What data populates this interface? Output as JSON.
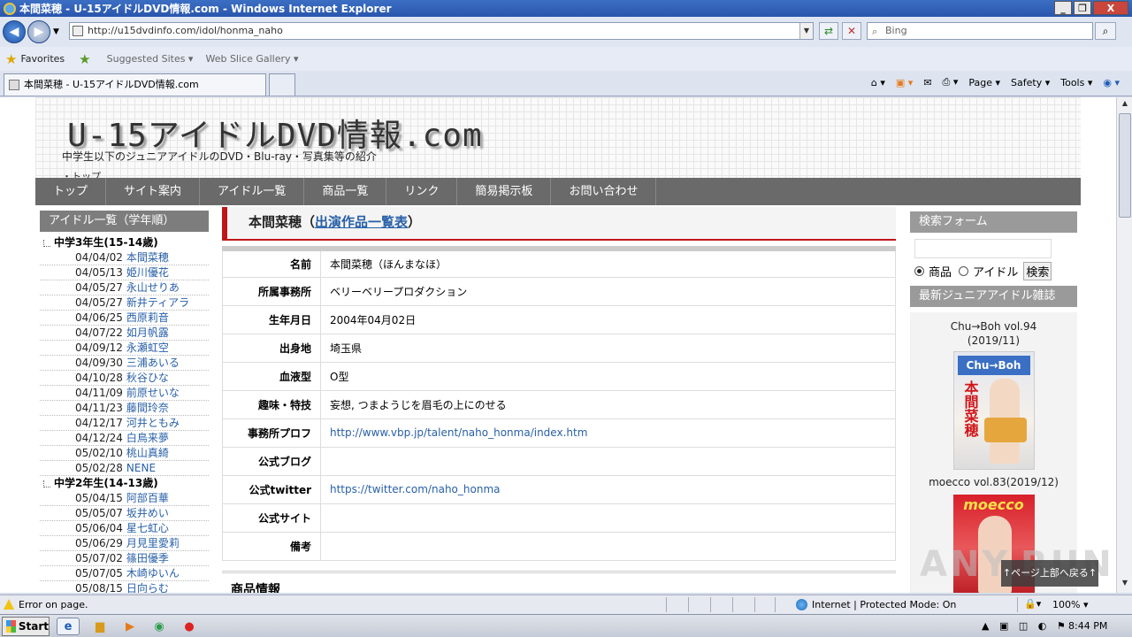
{
  "window": {
    "title": "本間菜穂 - U-15アイドルDVD情報.com - Windows Internet Explorer",
    "controls": [
      "_",
      "❐",
      "X"
    ]
  },
  "browser": {
    "address": "http://u15dvdinfo.com/idol/honma_naho",
    "search_placeholder": "Bing",
    "favorites_label": "Favorites",
    "suggested_sites": "Suggested Sites ▾",
    "web_slice": "Web Slice Gallery ▾",
    "tab_title": "本間菜穂 - U-15アイドルDVD情報.com",
    "commands": [
      "Page ▾",
      "Safety ▾",
      "Tools ▾"
    ]
  },
  "site": {
    "logo": "U-15アイドルDVD情報.com",
    "tagline": "中学生以下のジュニアアイドルのDVD・Blu-ray・写真集等の紹介",
    "crumb": "・トップ",
    "nav": [
      "トップ",
      "サイト案内",
      "アイドル一覧",
      "商品一覧",
      "リンク",
      "簡易掲示板",
      "お問い合わせ"
    ]
  },
  "left_sidebar": {
    "title": "アイドル一覧（学年順）",
    "groups": [
      {
        "grade": "中学3年生(15-14歳)",
        "idols": [
          {
            "date": "04/04/02",
            "name": "本間菜穂"
          },
          {
            "date": "04/05/13",
            "name": "姫川優花"
          },
          {
            "date": "04/05/27",
            "name": "永山せりあ"
          },
          {
            "date": "04/05/27",
            "name": "新井ティアラ"
          },
          {
            "date": "04/06/25",
            "name": "西原莉音"
          },
          {
            "date": "04/07/22",
            "name": "如月帆露"
          },
          {
            "date": "04/09/12",
            "name": "永瀬虹空"
          },
          {
            "date": "04/09/30",
            "name": "三浦あいる"
          },
          {
            "date": "04/10/28",
            "name": "秋谷ひな"
          },
          {
            "date": "04/11/09",
            "name": "前原せいな"
          },
          {
            "date": "04/11/23",
            "name": "藤間玲奈"
          },
          {
            "date": "04/12/17",
            "name": "河井ともみ"
          },
          {
            "date": "04/12/24",
            "name": "白鳥来夢"
          },
          {
            "date": "05/02/10",
            "name": "桃山真綺"
          },
          {
            "date": "05/02/28",
            "name": "NENE"
          }
        ]
      },
      {
        "grade": "中学2年生(14-13歳)",
        "idols": [
          {
            "date": "05/04/15",
            "name": "阿部百華"
          },
          {
            "date": "05/05/07",
            "name": "坂井めい"
          },
          {
            "date": "05/06/04",
            "name": "星七虹心"
          },
          {
            "date": "05/06/29",
            "name": "月見里愛莉"
          },
          {
            "date": "05/07/02",
            "name": "篠田優季"
          },
          {
            "date": "05/07/05",
            "name": "木崎ゆいん"
          },
          {
            "date": "05/08/15",
            "name": "日向らむ"
          }
        ]
      }
    ]
  },
  "main": {
    "title_name": "本間菜穂（",
    "title_link": "出演作品一覧表",
    "title_end": "）",
    "profile": [
      {
        "key": "名前",
        "value": "本間菜穂（ほんまなほ）"
      },
      {
        "key": "所属事務所",
        "value": "ベリーベリープロダクション"
      },
      {
        "key": "生年月日",
        "value": "2004年04月02日"
      },
      {
        "key": "出身地",
        "value": "埼玉県"
      },
      {
        "key": "血液型",
        "value": "O型"
      },
      {
        "key": "趣味・特技",
        "value": "妄想, つまようじを眉毛の上にのせる"
      },
      {
        "key": "事務所プロフ",
        "value": "http://www.vbp.jp/talent/naho_honma/index.htm",
        "link": true
      },
      {
        "key": "公式ブログ",
        "value": ""
      },
      {
        "key": "公式twitter",
        "value": "https://twitter.com/naho_honma",
        "link": true
      },
      {
        "key": "公式サイト",
        "value": ""
      },
      {
        "key": "備考",
        "value": ""
      }
    ],
    "section_title": "商品情報"
  },
  "right_sidebar": {
    "search_title": "検索フォーム",
    "search_opt1": "商品",
    "search_opt2": "アイドル",
    "search_button": "検索",
    "magazine_title": "最新ジュニアアイドル雑誌",
    "mag1_name": "Chu→Boh vol.94",
    "mag1_date": "(2019/11)",
    "mag1_logo": "Chu→Boh",
    "mag1_vertical": "本間菜穂",
    "mag2_name": "moecco vol.83(2019/12)",
    "mag2_logo": "moecco"
  },
  "overlay": {
    "to_top": "↑ページ上部へ戻る↑",
    "watermark": "ANY.RUN"
  },
  "statusbar": {
    "message": "Error on page.",
    "zone": "Internet | Protected Mode: On",
    "zoom": "100%  ▾"
  },
  "taskbar": {
    "start": "Start",
    "time": "8:44 PM"
  }
}
